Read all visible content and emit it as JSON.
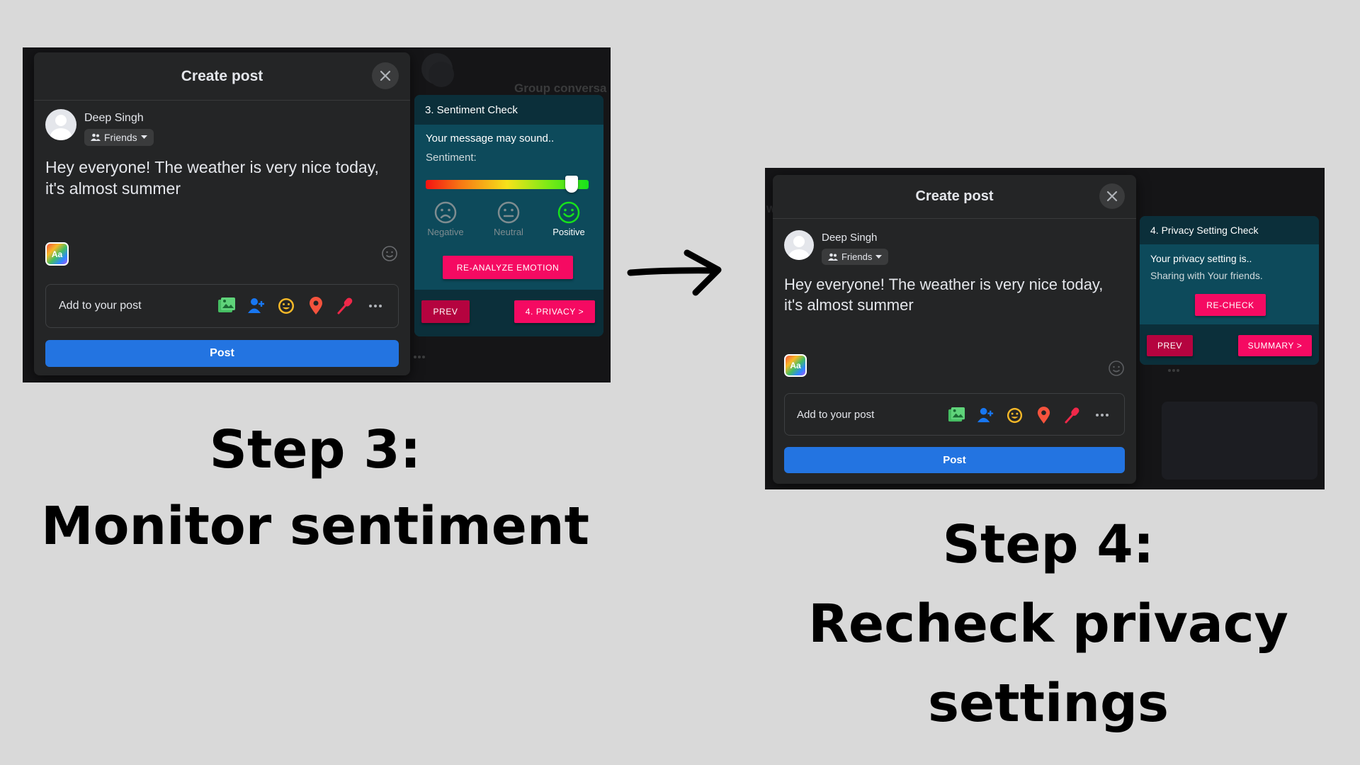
{
  "step3": {
    "modal": {
      "title": "Create post",
      "user_name": "Deep Singh",
      "audience": "Friends",
      "post_text_line1": "Hey everyone! The weather is very nice today,",
      "post_text_line2": "it's almost summer",
      "aa_label": "Aa",
      "add_label": "Add to your post",
      "post_button": "Post"
    },
    "background_text": "Group conversa",
    "panel": {
      "title": "3. Sentiment Check",
      "message": "Your message may sound..",
      "sentiment_label": "Sentiment:",
      "sentiment_value": 0.93,
      "options": [
        {
          "label": "Negative",
          "icon": "sad-face-icon"
        },
        {
          "label": "Neutral",
          "icon": "neutral-face-icon"
        },
        {
          "label": "Positive",
          "icon": "happy-face-icon"
        }
      ],
      "selected": "Positive",
      "reanalyze_button": "RE-ANALYZE EMOTION",
      "prev_button": "PREV",
      "next_button": "4. PRIVACY >"
    },
    "caption_line1": "Step 3:",
    "caption_line2": "Monitor sentiment"
  },
  "step4": {
    "modal": {
      "title": "Create post",
      "user_name": "Deep Singh",
      "audience": "Friends",
      "post_text_line1": "Hey everyone! The weather is very nice today,",
      "post_text_line2": "it's almost summer",
      "aa_label": "Aa",
      "add_label": "Add to your post",
      "post_button": "Post"
    },
    "panel": {
      "title": "4. Privacy Setting Check",
      "message": "Your privacy setting is..",
      "sub_message": "Sharing with Your friends.",
      "recheck_button": "RE-CHECK",
      "prev_button": "PREV",
      "next_button": "SUMMARY >"
    },
    "caption_line1": "Step 4:",
    "caption_line2": "Recheck privacy",
    "caption_line3": "settings"
  },
  "colors": {
    "page_bg": "#d9d9d9",
    "modal_bg": "#242526",
    "panel_bg": "#0d4a5b",
    "accent_pink": "#f50a62",
    "prev_red": "#b5033f",
    "post_blue": "#2374e1",
    "positive_green": "#16e21b"
  },
  "add_icons": [
    "photo-icon",
    "tag-people-icon",
    "feeling-icon",
    "location-icon",
    "live-mic-icon",
    "more-icon"
  ]
}
